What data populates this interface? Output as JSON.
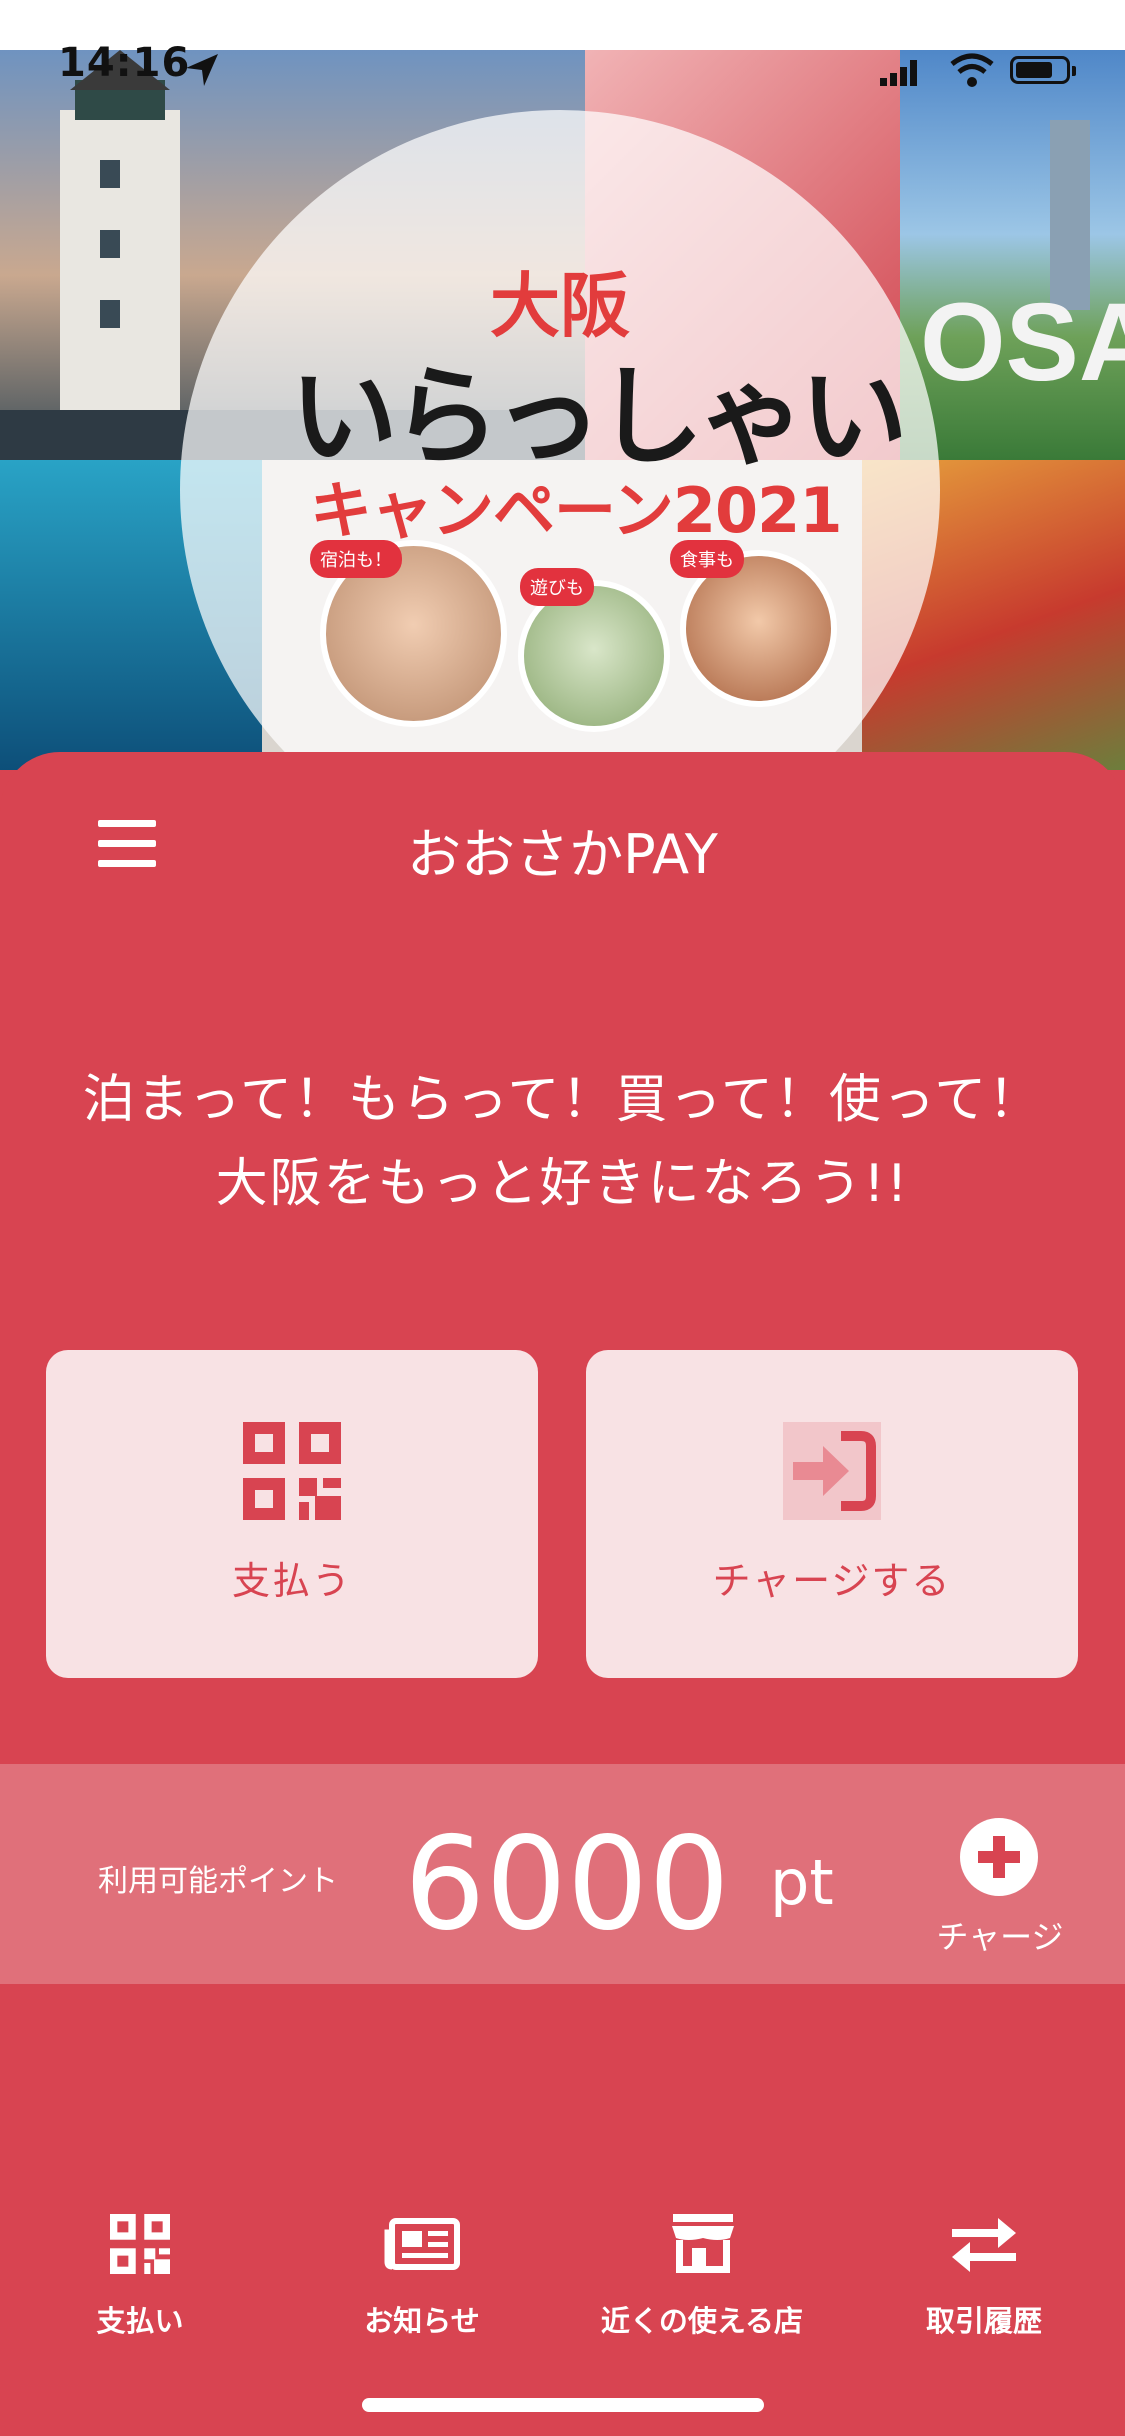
{
  "status_bar": {
    "time": "14:16"
  },
  "hero": {
    "title_line1": "大阪",
    "title_line2": "いらっしゃい",
    "title_line3": "キャンペーン2021",
    "badges": [
      "宿泊も！",
      "遊びも",
      "食事も"
    ],
    "sign_text": "OSAKA"
  },
  "header": {
    "app_title": "おおさかPAY"
  },
  "tagline": {
    "line1": "泊まって！もらって！買って！使って！",
    "line2": "大阪をもっと好きになろう!!"
  },
  "actions": [
    {
      "label": "支払う",
      "icon": "qr-code-icon"
    },
    {
      "label": "チャージする",
      "icon": "sign-in-arrow-icon"
    }
  ],
  "points": {
    "label": "利用可能ポイント",
    "value": "6000",
    "unit": "pt",
    "charge_label": "チャージ"
  },
  "bottom_nav": [
    {
      "label": "支払い",
      "icon": "qr-code-icon"
    },
    {
      "label": "お知らせ",
      "icon": "newspaper-icon"
    },
    {
      "label": "近くの使える店",
      "icon": "store-icon"
    },
    {
      "label": "取引履歴",
      "icon": "exchange-arrows-icon"
    }
  ],
  "colors": {
    "primary": "#d84451",
    "card_tile": "#f8e2e4",
    "points_band": "#e0707a",
    "white": "#ffffff"
  }
}
